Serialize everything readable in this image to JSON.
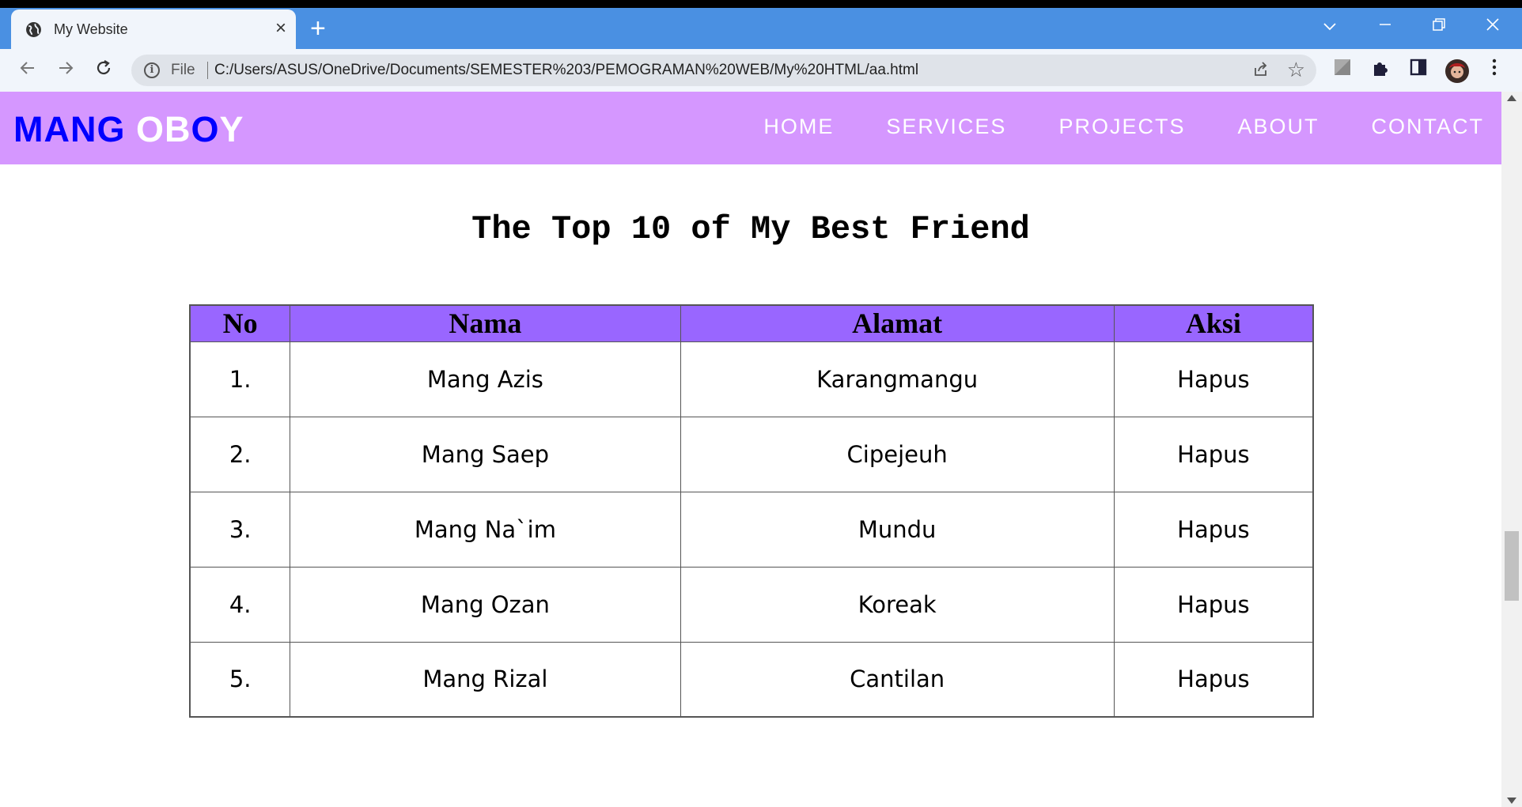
{
  "browser": {
    "tab_title": "My Website",
    "tab_close": "×",
    "new_tab": "+",
    "file_label": "File",
    "url": "C:/Users/ASUS/OneDrive/Documents/SEMESTER%203/PEMOGRAMAN%20WEB/My%20HTML/aa.html",
    "icons": [
      "globe-icon",
      "back-icon",
      "forward-icon",
      "reload-icon",
      "info-icon",
      "share-icon",
      "star-icon",
      "extension-icon",
      "puzzle-icon",
      "sidepanel-icon",
      "avatar",
      "menu-icon"
    ]
  },
  "site": {
    "brand": {
      "part1": "MANG ",
      "part2": "OB",
      "part3": "O",
      "part4": "Y"
    },
    "nav": [
      "HOME",
      "SERVICES",
      "PROJECTS",
      "ABOUT",
      "CONTACT"
    ],
    "colors": {
      "navbar": "#d597ff",
      "table_header": "#9966ff",
      "brand_blue": "#0000ff"
    }
  },
  "main": {
    "heading": "The Top 10 of My Best Friend",
    "table": {
      "headers": [
        "No",
        "Nama",
        "Alamat",
        "Aksi"
      ],
      "rows": [
        {
          "no": "1.",
          "nama": "Mang Azis",
          "alamat": "Karangmangu",
          "aksi": "Hapus"
        },
        {
          "no": "2.",
          "nama": "Mang Saep",
          "alamat": "Cipejeuh",
          "aksi": "Hapus"
        },
        {
          "no": "3.",
          "nama": "Mang Na`im",
          "alamat": "Mundu",
          "aksi": "Hapus"
        },
        {
          "no": "4.",
          "nama": "Mang Ozan",
          "alamat": "Koreak",
          "aksi": "Hapus"
        },
        {
          "no": "5.",
          "nama": "Mang Rizal",
          "alamat": "Cantilan",
          "aksi": "Hapus"
        }
      ]
    }
  }
}
